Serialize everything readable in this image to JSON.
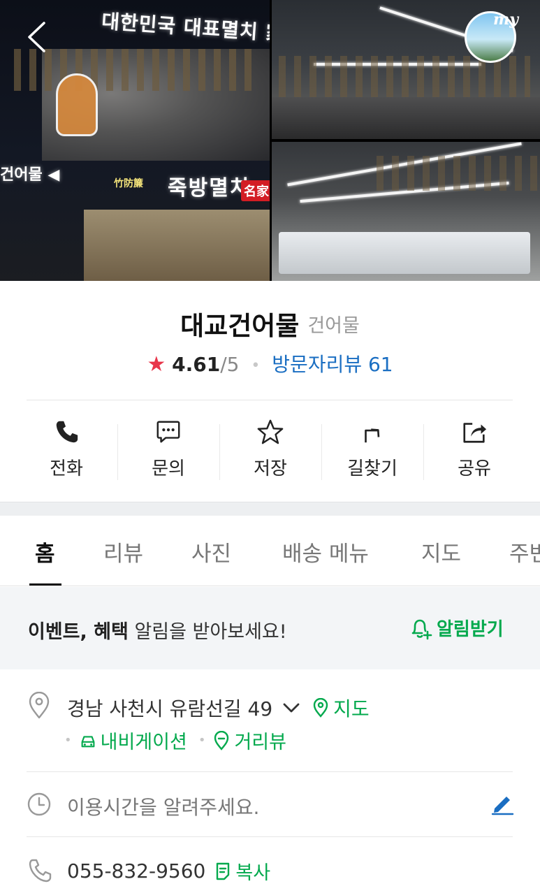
{
  "header": {
    "back_icon": "chevron-left-icon",
    "my_badge_label": "my",
    "photo_sign_main": "대한민국 대표멸치 家 대교건어",
    "photo_sign_left": "건어물 ◀",
    "photo_sign_store": "죽방멸치",
    "photo_sign_badge": "名家",
    "photo_sign_small": "竹防簾"
  },
  "place": {
    "name": "대교건어물",
    "category": "건어물",
    "rating": "4.61",
    "rating_max": "/5",
    "review_label": "방문자리뷰 61"
  },
  "actions": [
    {
      "label": "전화",
      "icon": "phone-icon"
    },
    {
      "label": "문의",
      "icon": "chat-icon"
    },
    {
      "label": "저장",
      "icon": "star-icon"
    },
    {
      "label": "길찾기",
      "icon": "directions-icon"
    },
    {
      "label": "공유",
      "icon": "share-icon"
    }
  ],
  "tabs": [
    {
      "label": "홈",
      "active": true
    },
    {
      "label": "리뷰"
    },
    {
      "label": "사진"
    },
    {
      "label": "배송 메뉴"
    },
    {
      "label": "지도"
    },
    {
      "label": "주변"
    }
  ],
  "notice": {
    "bold_part": "이벤트, 혜택",
    "rest": " 알림을 받아보세요!",
    "button": "알림받기"
  },
  "info": {
    "address": "경남 사천시 유람선길 49",
    "map_link": "지도",
    "navigation_link": "내비게이션",
    "street_view_link": "거리뷰",
    "hours_placeholder": "이용시간을 알려주세요.",
    "phone": "055-832-9560",
    "copy_link": "복사"
  },
  "colors": {
    "accent_green": "#03a94d",
    "link_blue": "#1a6ec2",
    "star_red": "#e8354a"
  }
}
